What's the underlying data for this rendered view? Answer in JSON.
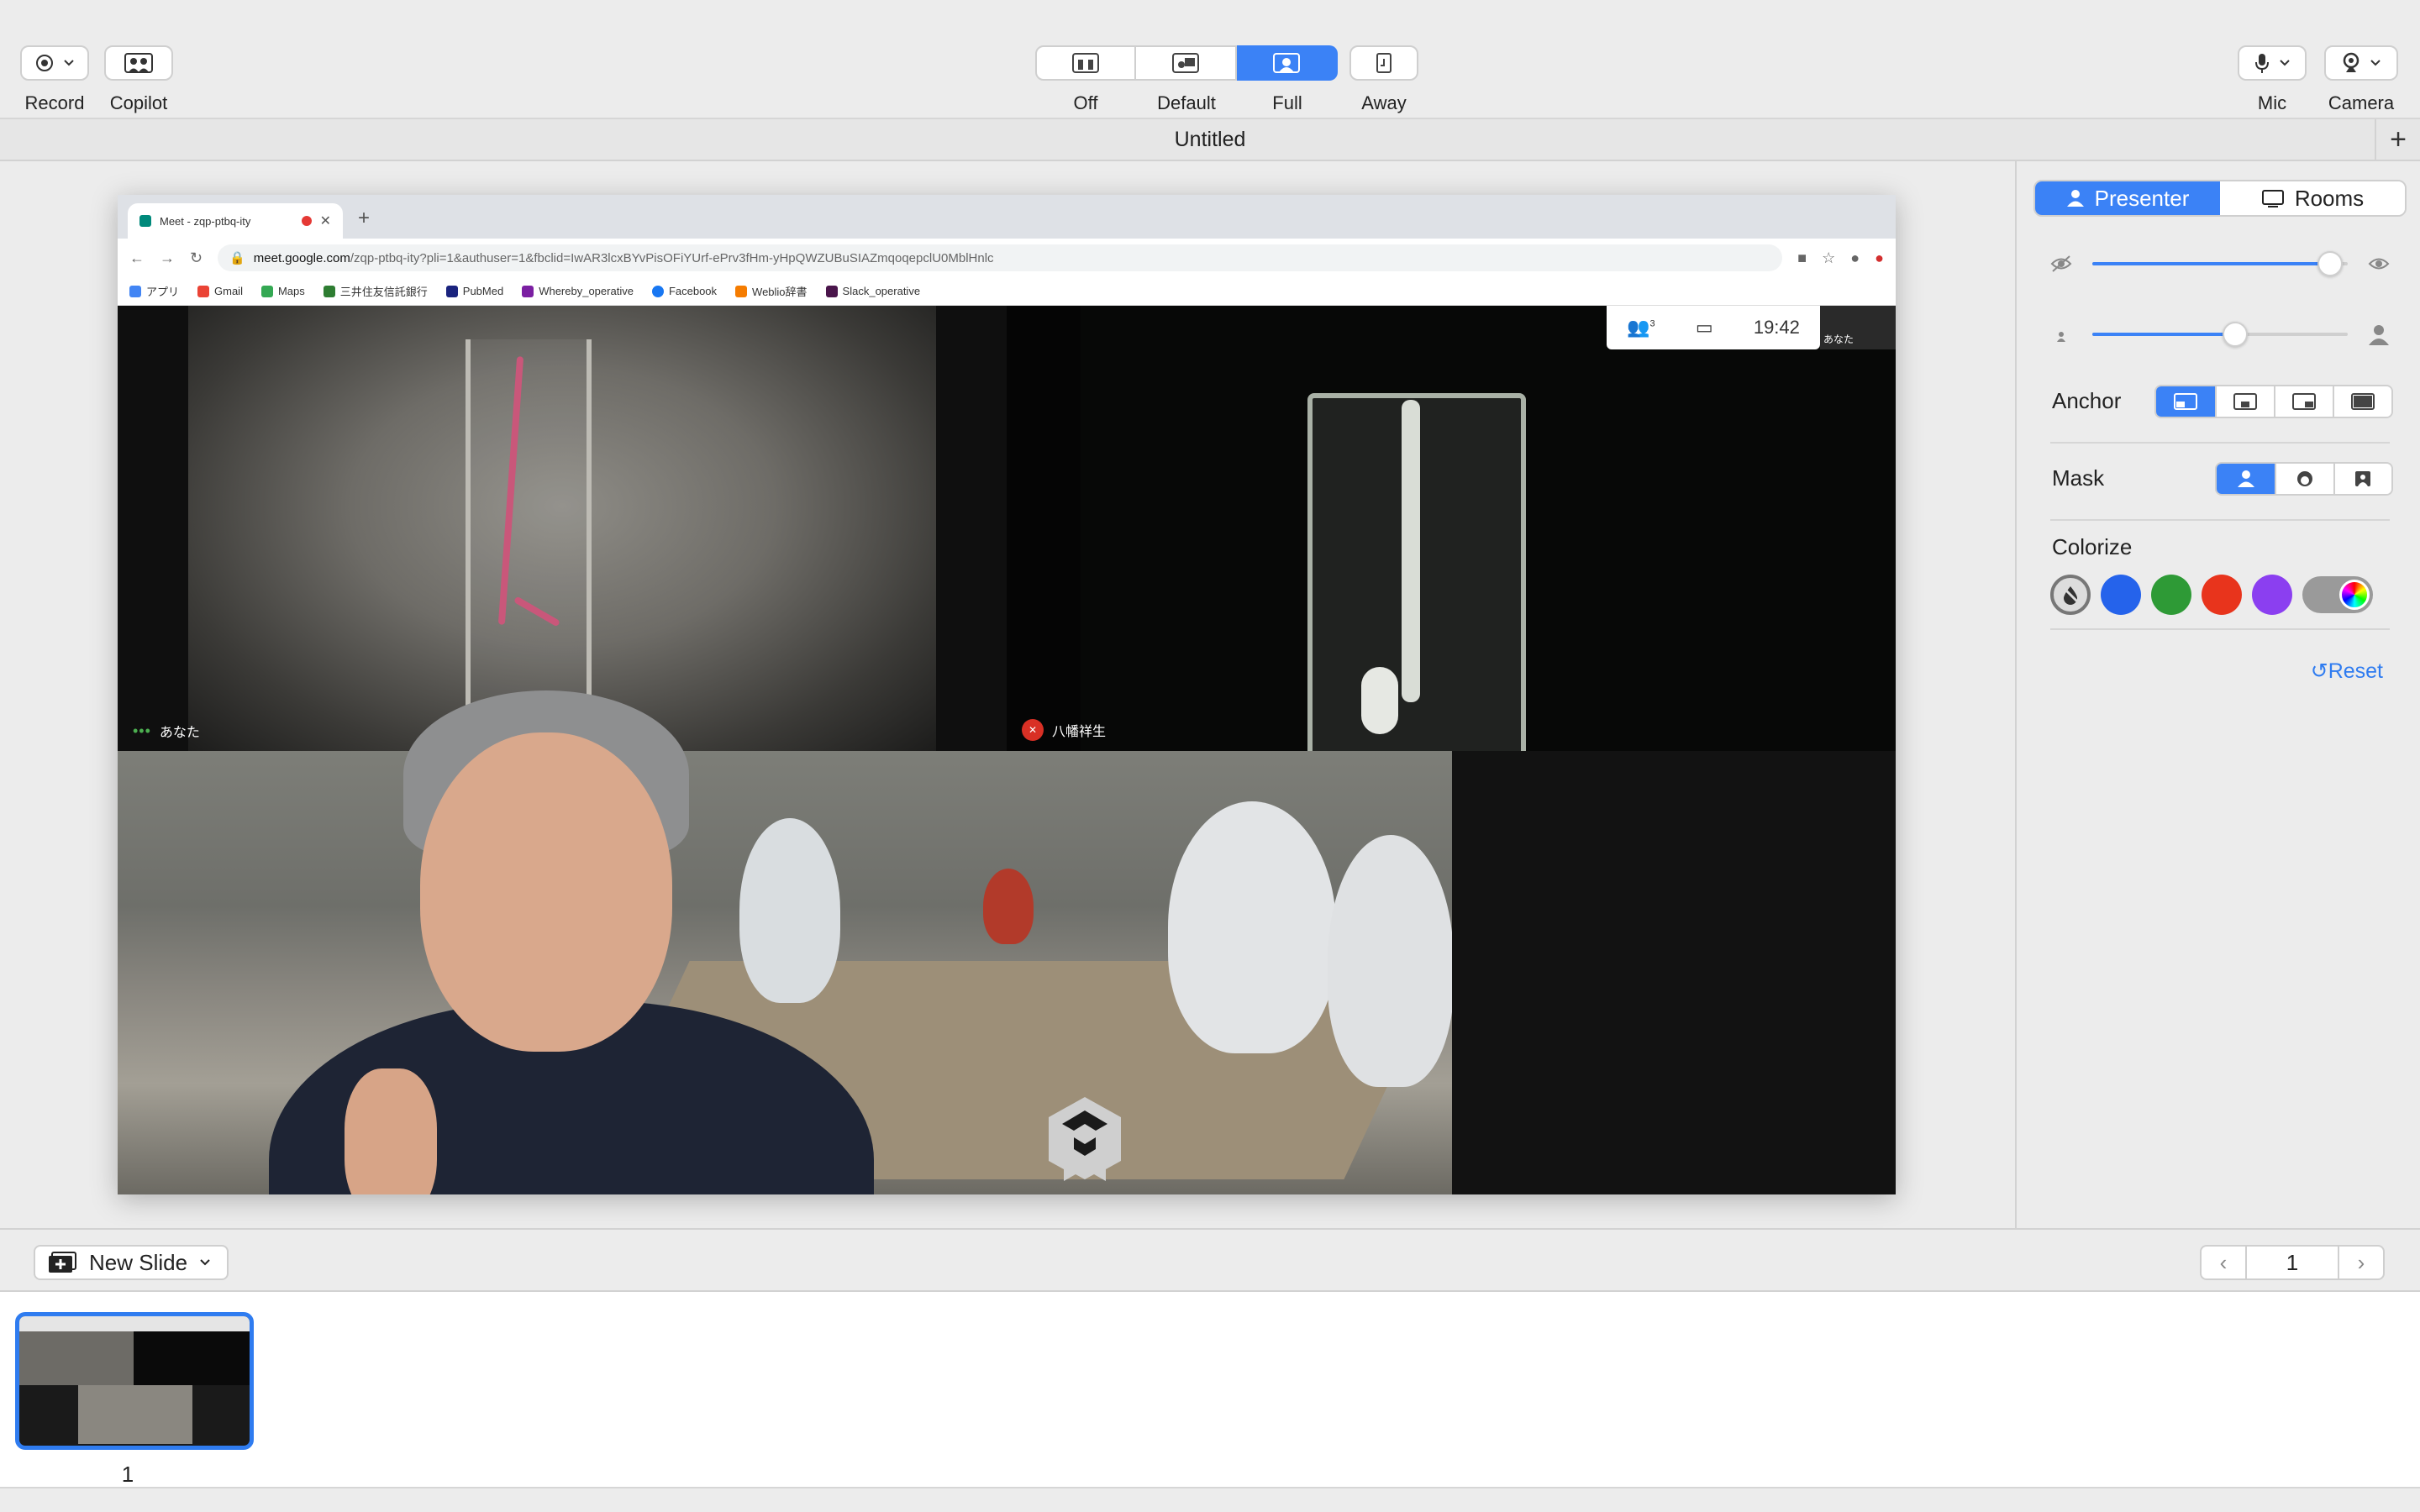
{
  "toolbar": {
    "record_label": "Record",
    "copilot_label": "Copilot",
    "modes": [
      {
        "label": "Off",
        "active": false
      },
      {
        "label": "Default",
        "active": false
      },
      {
        "label": "Full",
        "active": true
      }
    ],
    "away_label": "Away",
    "mic_label": "Mic",
    "camera_label": "Camera",
    "accent": "#3b82f6"
  },
  "document": {
    "title": "Untitled",
    "add_label": "+"
  },
  "slide_screen": {
    "tab_title": "Meet - zqp-ptbq-ity",
    "url_host": "meet.google.com",
    "url_rest": "/zqp-ptbq-ity?pli=1&authuser=1&fbclid=IwAR3lcxBYvPisOFiYUrf-ePrv3fHm-yHpQWZUBuSIAZmqoqepclU0MblHnlc",
    "bookmarks": [
      "アプリ",
      "Gmail",
      "Maps",
      "三井住友信託銀行",
      "PubMed",
      "Whereby_operative",
      "Facebook",
      "Weblio辞書",
      "Slack_operative"
    ],
    "meet": {
      "tile1_name": "あなた",
      "tile2_name": "八幡祥生",
      "self_name": "あなた",
      "time": "19:42",
      "participants_count": "3"
    }
  },
  "sidebar": {
    "tabs": [
      {
        "label": "Presenter",
        "active": true
      },
      {
        "label": "Rooms",
        "active": false
      }
    ],
    "opacity_fraction": 0.93,
    "size_fraction": 0.56,
    "anchor_label": "Anchor",
    "anchor_selected_index": 0,
    "mask_label": "Mask",
    "mask_selected_index": 0,
    "colorize_label": "Colorize",
    "colors": [
      "#2563eb",
      "#2e9a36",
      "#e8341c",
      "#8b3ff0"
    ],
    "reset_label": "Reset"
  },
  "slides": {
    "new_slide_label": "New Slide",
    "current_page": "1",
    "thumbnails": [
      {
        "number": "1"
      }
    ]
  }
}
